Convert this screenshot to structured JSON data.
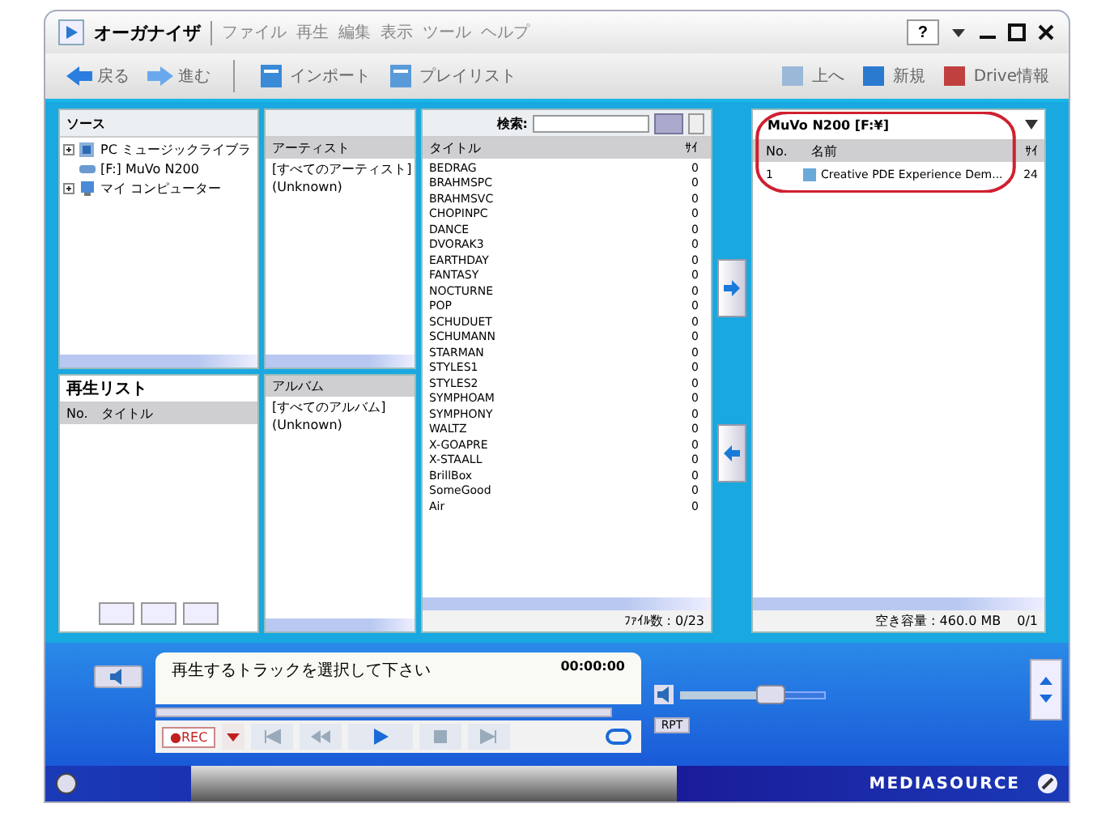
{
  "window": {
    "title": "オーガナイザ",
    "menu": [
      "ファイル",
      "再生",
      "編集",
      "表示",
      "ツール",
      "ヘルプ"
    ],
    "help": "?"
  },
  "toolbar": {
    "left": [
      {
        "label": "戻る",
        "kind": "back"
      },
      {
        "label": "進む",
        "kind": "forward"
      },
      {
        "label": "インポート",
        "kind": "import"
      },
      {
        "label": "プレイリスト",
        "kind": "playlist"
      }
    ],
    "right": [
      {
        "label": "上へ",
        "kind": "up"
      },
      {
        "label": "新規",
        "kind": "new"
      },
      {
        "label": "Drive情報",
        "kind": "drive"
      }
    ]
  },
  "source": {
    "title": "ソース",
    "tree": [
      {
        "label": "PC ミュージックライブラ",
        "expanded": false,
        "kind": "library"
      },
      {
        "label": "[F:] MuVo N200",
        "kind": "player"
      },
      {
        "label": "マイ コンピューター",
        "expanded": false,
        "kind": "computer"
      }
    ]
  },
  "playlist": {
    "title": "再生リスト",
    "columns": [
      "No.",
      "タイトル"
    ]
  },
  "artists": {
    "title": "アーティスト",
    "items": [
      "[すべてのアーティスト]",
      "(Unknown)"
    ]
  },
  "albums": {
    "title": "アルバム",
    "items": [
      "[すべてのアルバム]",
      "(Unknown)"
    ]
  },
  "search": {
    "label": "検索:"
  },
  "tracks": {
    "columns": [
      "タイトル",
      "ｻｲ"
    ],
    "rows": [
      [
        "BEDRAG",
        "0"
      ],
      [
        "BRAHMSPC",
        "0"
      ],
      [
        "BRAHMSVC",
        "0"
      ],
      [
        "CHOPINPC",
        "0"
      ],
      [
        "DANCE",
        "0"
      ],
      [
        "DVORAK3",
        "0"
      ],
      [
        "EARTHDAY",
        "0"
      ],
      [
        "FANTASY",
        "0"
      ],
      [
        "NOCTURNE",
        "0"
      ],
      [
        "POP",
        "0"
      ],
      [
        "SCHUDUET",
        "0"
      ],
      [
        "SCHUMANN",
        "0"
      ],
      [
        "STARMAN",
        "0"
      ],
      [
        "STYLES1",
        "0"
      ],
      [
        "STYLES2",
        "0"
      ],
      [
        "SYMPHOAM",
        "0"
      ],
      [
        "SYMPHONY",
        "0"
      ],
      [
        "WALTZ",
        "0"
      ],
      [
        "X-GOAPRE",
        "0"
      ],
      [
        "X-STAALL",
        "0"
      ],
      [
        "BrillBox",
        "0"
      ],
      [
        "SomeGood",
        "0"
      ],
      [
        "Air",
        "0"
      ]
    ],
    "footer": "ﾌｧｲﾙ数 : 0/23"
  },
  "device": {
    "title": "MuVo N200 [F:¥]",
    "columns": [
      "No.",
      "名前",
      "ｻｲ"
    ],
    "rows": [
      [
        "1",
        "Creative PDE Experience Dem...",
        "24"
      ]
    ],
    "free": "空き容量 : 460.0 MB",
    "count": "0/1"
  },
  "player": {
    "message": "再生するトラックを選択して下さい",
    "time": "00:00:00",
    "rec": "●REC",
    "repeat": "RPT",
    "level": 0.62,
    "logo": "MEDIASOURCE"
  }
}
